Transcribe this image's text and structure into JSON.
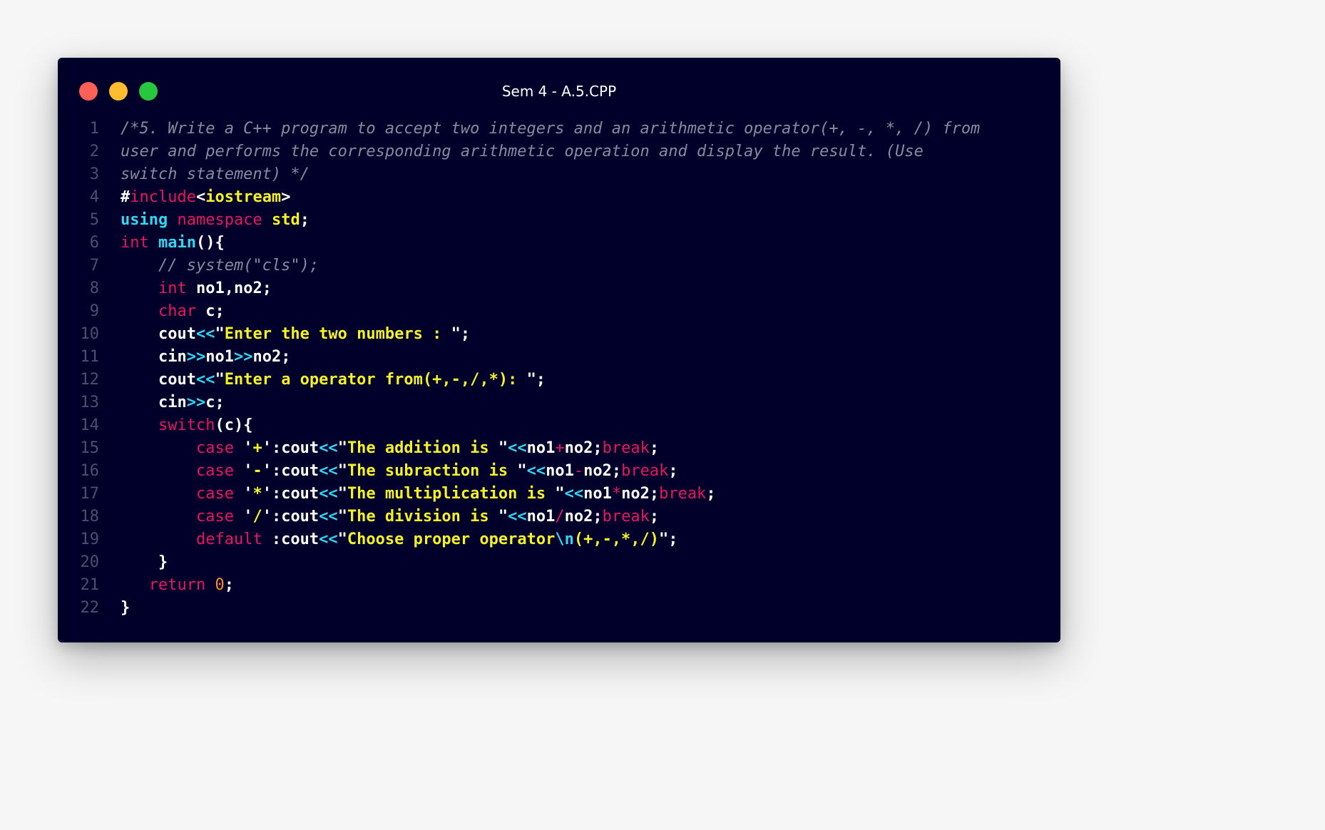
{
  "window": {
    "title": "Sem 4 - A.5.CPP"
  },
  "code": {
    "lines": [
      {
        "n": "1",
        "tokens": [
          [
            "c",
            "/*5. Write a C++ program to accept two integers and an arithmetic operator(+, -, *, /) from"
          ]
        ]
      },
      {
        "n": "2",
        "tokens": [
          [
            "c",
            "user and performs the corresponding arithmetic operation and display the result. (Use"
          ]
        ]
      },
      {
        "n": "3",
        "tokens": [
          [
            "c",
            "switch statement) */"
          ]
        ]
      },
      {
        "n": "4",
        "tokens": [
          [
            "p",
            "#"
          ],
          [
            "k",
            "include"
          ],
          [
            "p",
            "<"
          ],
          [
            "s",
            "iostream"
          ],
          [
            "p",
            ">"
          ]
        ]
      },
      {
        "n": "5",
        "tokens": [
          [
            "t",
            "using"
          ],
          [
            "p",
            " "
          ],
          [
            "k",
            "namespace"
          ],
          [
            "p",
            " "
          ],
          [
            "s",
            "std"
          ],
          [
            "p",
            ";"
          ]
        ]
      },
      {
        "n": "6",
        "tokens": [
          [
            "k",
            "int"
          ],
          [
            "p",
            " "
          ],
          [
            "t",
            "main"
          ],
          [
            "p",
            "(){"
          ]
        ]
      },
      {
        "n": "7",
        "tokens": [
          [
            "p",
            "    "
          ],
          [
            "c",
            "// system(\"cls\");"
          ]
        ]
      },
      {
        "n": "8",
        "tokens": [
          [
            "p",
            "    "
          ],
          [
            "k",
            "int"
          ],
          [
            "p",
            " no1,no2;"
          ]
        ]
      },
      {
        "n": "9",
        "tokens": [
          [
            "p",
            "    "
          ],
          [
            "k",
            "char"
          ],
          [
            "p",
            " c;"
          ]
        ]
      },
      {
        "n": "10",
        "tokens": [
          [
            "p",
            "    cout"
          ],
          [
            "o",
            "<<"
          ],
          [
            "p",
            "\""
          ],
          [
            "s",
            "Enter the two numbers : "
          ],
          [
            "p",
            "\";"
          ]
        ]
      },
      {
        "n": "11",
        "tokens": [
          [
            "p",
            "    cin"
          ],
          [
            "o",
            ">>"
          ],
          [
            "p",
            "no1"
          ],
          [
            "o",
            ">>"
          ],
          [
            "p",
            "no2;"
          ]
        ]
      },
      {
        "n": "12",
        "tokens": [
          [
            "p",
            "    cout"
          ],
          [
            "o",
            "<<"
          ],
          [
            "p",
            "\""
          ],
          [
            "s",
            "Enter a operator from(+,-,/,*): "
          ],
          [
            "p",
            "\";"
          ]
        ]
      },
      {
        "n": "13",
        "tokens": [
          [
            "p",
            "    cin"
          ],
          [
            "o",
            ">>"
          ],
          [
            "p",
            "c;"
          ]
        ]
      },
      {
        "n": "14",
        "tokens": [
          [
            "p",
            "    "
          ],
          [
            "k",
            "switch"
          ],
          [
            "p",
            "(c){"
          ]
        ]
      },
      {
        "n": "15",
        "tokens": [
          [
            "p",
            "        "
          ],
          [
            "k",
            "case"
          ],
          [
            "p",
            " '"
          ],
          [
            "s",
            "+"
          ],
          [
            "p",
            "':cout"
          ],
          [
            "o",
            "<<"
          ],
          [
            "p",
            "\""
          ],
          [
            "s",
            "The addition is "
          ],
          [
            "p",
            "\""
          ],
          [
            "o",
            "<<"
          ],
          [
            "p",
            "no1"
          ],
          [
            "k",
            "+"
          ],
          [
            "p",
            "no2;"
          ],
          [
            "k",
            "break"
          ],
          [
            "p",
            ";"
          ]
        ]
      },
      {
        "n": "16",
        "tokens": [
          [
            "p",
            "        "
          ],
          [
            "k",
            "case"
          ],
          [
            "p",
            " '"
          ],
          [
            "s",
            "-"
          ],
          [
            "p",
            "':cout"
          ],
          [
            "o",
            "<<"
          ],
          [
            "p",
            "\""
          ],
          [
            "s",
            "The subraction is "
          ],
          [
            "p",
            "\""
          ],
          [
            "o",
            "<<"
          ],
          [
            "p",
            "no1"
          ],
          [
            "k",
            "-"
          ],
          [
            "p",
            "no2;"
          ],
          [
            "k",
            "break"
          ],
          [
            "p",
            ";"
          ]
        ]
      },
      {
        "n": "17",
        "tokens": [
          [
            "p",
            "        "
          ],
          [
            "k",
            "case"
          ],
          [
            "p",
            " '"
          ],
          [
            "s",
            "*"
          ],
          [
            "p",
            "':cout"
          ],
          [
            "o",
            "<<"
          ],
          [
            "p",
            "\""
          ],
          [
            "s",
            "The multiplication is "
          ],
          [
            "p",
            "\""
          ],
          [
            "o",
            "<<"
          ],
          [
            "p",
            "no1"
          ],
          [
            "k",
            "*"
          ],
          [
            "p",
            "no2;"
          ],
          [
            "k",
            "break"
          ],
          [
            "p",
            ";"
          ]
        ]
      },
      {
        "n": "18",
        "tokens": [
          [
            "p",
            "        "
          ],
          [
            "k",
            "case"
          ],
          [
            "p",
            " '"
          ],
          [
            "s",
            "/"
          ],
          [
            "p",
            "':cout"
          ],
          [
            "o",
            "<<"
          ],
          [
            "p",
            "\""
          ],
          [
            "s",
            "The division is "
          ],
          [
            "p",
            "\""
          ],
          [
            "o",
            "<<"
          ],
          [
            "p",
            "no1"
          ],
          [
            "k",
            "/"
          ],
          [
            "p",
            "no2;"
          ],
          [
            "k",
            "break"
          ],
          [
            "p",
            ";"
          ]
        ]
      },
      {
        "n": "19",
        "tokens": [
          [
            "p",
            "        "
          ],
          [
            "k",
            "default"
          ],
          [
            "p",
            " :cout"
          ],
          [
            "o",
            "<<"
          ],
          [
            "p",
            "\""
          ],
          [
            "s",
            "Choose proper operator"
          ],
          [
            "t",
            "\\n"
          ],
          [
            "s",
            "(+,-,*,/)"
          ],
          [
            "p",
            "\";"
          ]
        ]
      },
      {
        "n": "20",
        "tokens": [
          [
            "p",
            "    }"
          ]
        ]
      },
      {
        "n": "21",
        "tokens": [
          [
            "p",
            "   "
          ],
          [
            "k",
            "return"
          ],
          [
            "p",
            " "
          ],
          [
            "d",
            "0"
          ],
          [
            "p",
            ";"
          ]
        ]
      },
      {
        "n": "22",
        "tokens": [
          [
            "p",
            "}"
          ]
        ]
      }
    ]
  },
  "colors": {
    "background": "#01002a",
    "keyword": "#e9155e",
    "type_function": "#2fd7f0",
    "string": "#f4f227",
    "comment": "#8a8a9e",
    "number": "#ff8c2a",
    "line_number": "#4b4f72"
  }
}
